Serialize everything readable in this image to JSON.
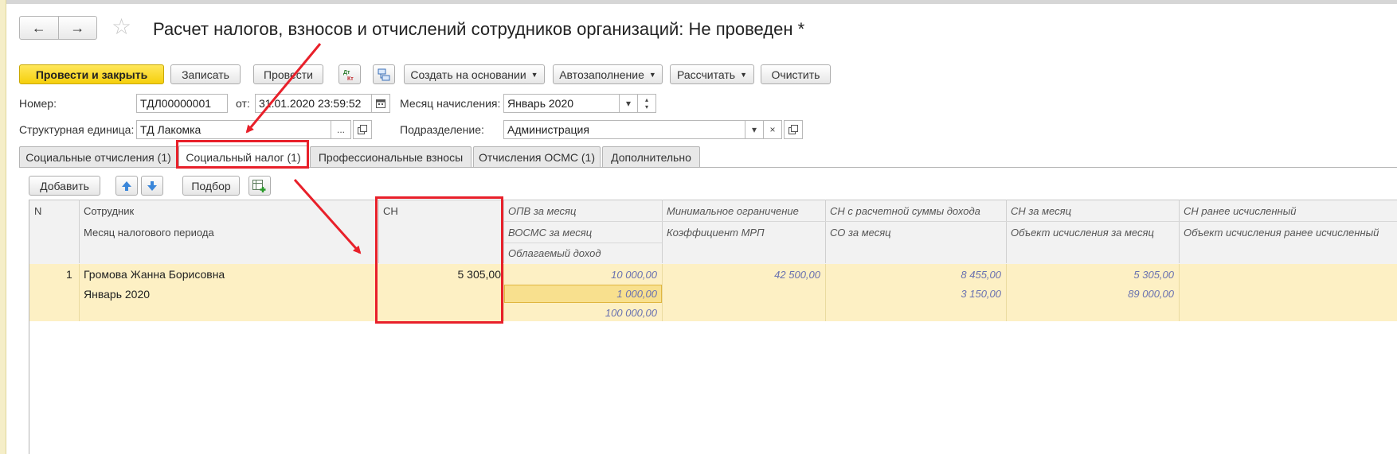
{
  "window": {
    "title": "Расчет налогов, взносов и отчислений сотрудников организаций: Не проведен *"
  },
  "toolbar": {
    "post_close": "Провести и закрыть",
    "save": "Записать",
    "post": "Провести",
    "create_based": "Создать на основании",
    "autofill": "Автозаполнение",
    "calculate": "Рассчитать",
    "clear": "Очистить"
  },
  "form": {
    "number_label": "Номер:",
    "number_value": "ТДЛ00000001",
    "from_label": "от:",
    "date_value": "31.01.2020 23:59:52",
    "month_label": "Месяц начисления:",
    "month_value": "Январь 2020",
    "unit_label": "Структурная единица:",
    "unit_value": "ТД Лакомка",
    "dept_label": "Подразделение:",
    "dept_value": "Администрация",
    "ellipsis": "...",
    "clear_x": "×"
  },
  "tabs": [
    {
      "label": "Социальные отчисления (1)"
    },
    {
      "label": "Социальный налог (1)"
    },
    {
      "label": "Профессиональные взносы"
    },
    {
      "label": "Отчисления ОСМС (1)"
    },
    {
      "label": "Дополнительно"
    }
  ],
  "table_toolbar": {
    "add": "Добавить",
    "pick": "Подбор"
  },
  "columns": {
    "n": "N",
    "employee": "Сотрудник",
    "tax_period_month": "Месяц налогового периода",
    "sn": "СН",
    "opv_month": "ОПВ за месяц",
    "vosms_month": "ВОСМС за месяц",
    "taxable_income": "Облагаемый доход",
    "min_limit": "Минимальное ограничение",
    "mrp_coef": "Коэффициент МРП",
    "sn_calc_income": "СН с расчетной суммы дохода",
    "so_month": "СО за месяц",
    "sn_month": "СН за месяц",
    "base_month": "Объект исчисления за месяц",
    "sn_prev": "СН ранее исчисленный",
    "base_prev": "Объект исчисления ранее исчисленный"
  },
  "rows": [
    {
      "n": "1",
      "employee": "Громова Жанна Борисовна",
      "month": "Январь 2020",
      "sn": "5 305,00",
      "opv": "10 000,00",
      "vosms": "1 000,00",
      "taxable": "100 000,00",
      "min_limit": "42 500,00",
      "sn_calc": "8 455,00",
      "so_month": "3 150,00",
      "sn_month": "5 305,00",
      "base_month": "89 000,00"
    }
  ]
}
